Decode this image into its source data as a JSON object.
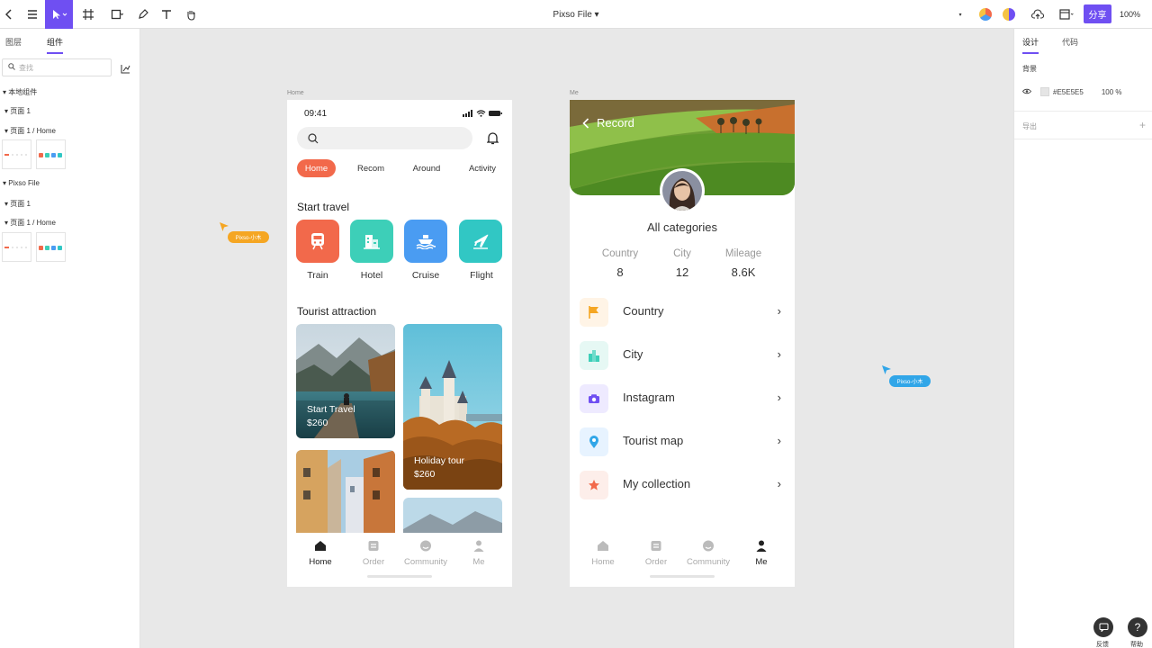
{
  "toolbar": {
    "file_title": "Pixso File",
    "share_label": "分享",
    "zoom": "100%"
  },
  "left_panel": {
    "tabs": [
      "图层",
      "组件"
    ],
    "search_placeholder": "查找",
    "items": {
      "local": "本地组件",
      "page1": "页面 1",
      "page1_home": "页面 1 / Home",
      "file": "Pixso File",
      "file_page1": "页面 1",
      "file_page1_home": "页面 1 / Home"
    }
  },
  "right_panel": {
    "tabs": [
      "设计",
      "代码"
    ],
    "background_label": "背景",
    "color_hex": "#E5E5E5",
    "opacity": "100 %",
    "export_label": "导出"
  },
  "canvas": {
    "home_frame_label": "Home",
    "me_frame_label": "Me",
    "cursor1": "Pixso-小木",
    "cursor2": "Pixso-小木"
  },
  "home": {
    "time": "09:41",
    "tabs": [
      "Home",
      "Recom",
      "Around",
      "Activity"
    ],
    "start_travel": "Start travel",
    "categories": [
      "Train",
      "Hotel",
      "Cruise",
      "Flight"
    ],
    "tourist_attraction": "Tourist attraction",
    "card1_title": "Start Travel",
    "card1_price": "$260",
    "card2_title": "Holiday tour",
    "card2_price": "$260"
  },
  "tabbar": {
    "items": [
      "Home",
      "Order",
      "Community",
      "Me"
    ]
  },
  "me": {
    "back_label": "Record",
    "all_categories": "All categories",
    "stats": [
      {
        "label": "Country",
        "value": "8"
      },
      {
        "label": "City",
        "value": "12"
      },
      {
        "label": "Mileage",
        "value": "8.6K"
      }
    ],
    "menu": [
      "Country",
      "City",
      "Instagram",
      "Tourist map",
      "My collection"
    ]
  },
  "bottom_right": {
    "feedback": "反馈",
    "help": "帮助"
  },
  "colors": {
    "accent": "#6f4ff2",
    "orange": "#f2694b",
    "teal": "#3dcfb8",
    "blue": "#4a9cf2",
    "cyan": "#31c7c4"
  }
}
